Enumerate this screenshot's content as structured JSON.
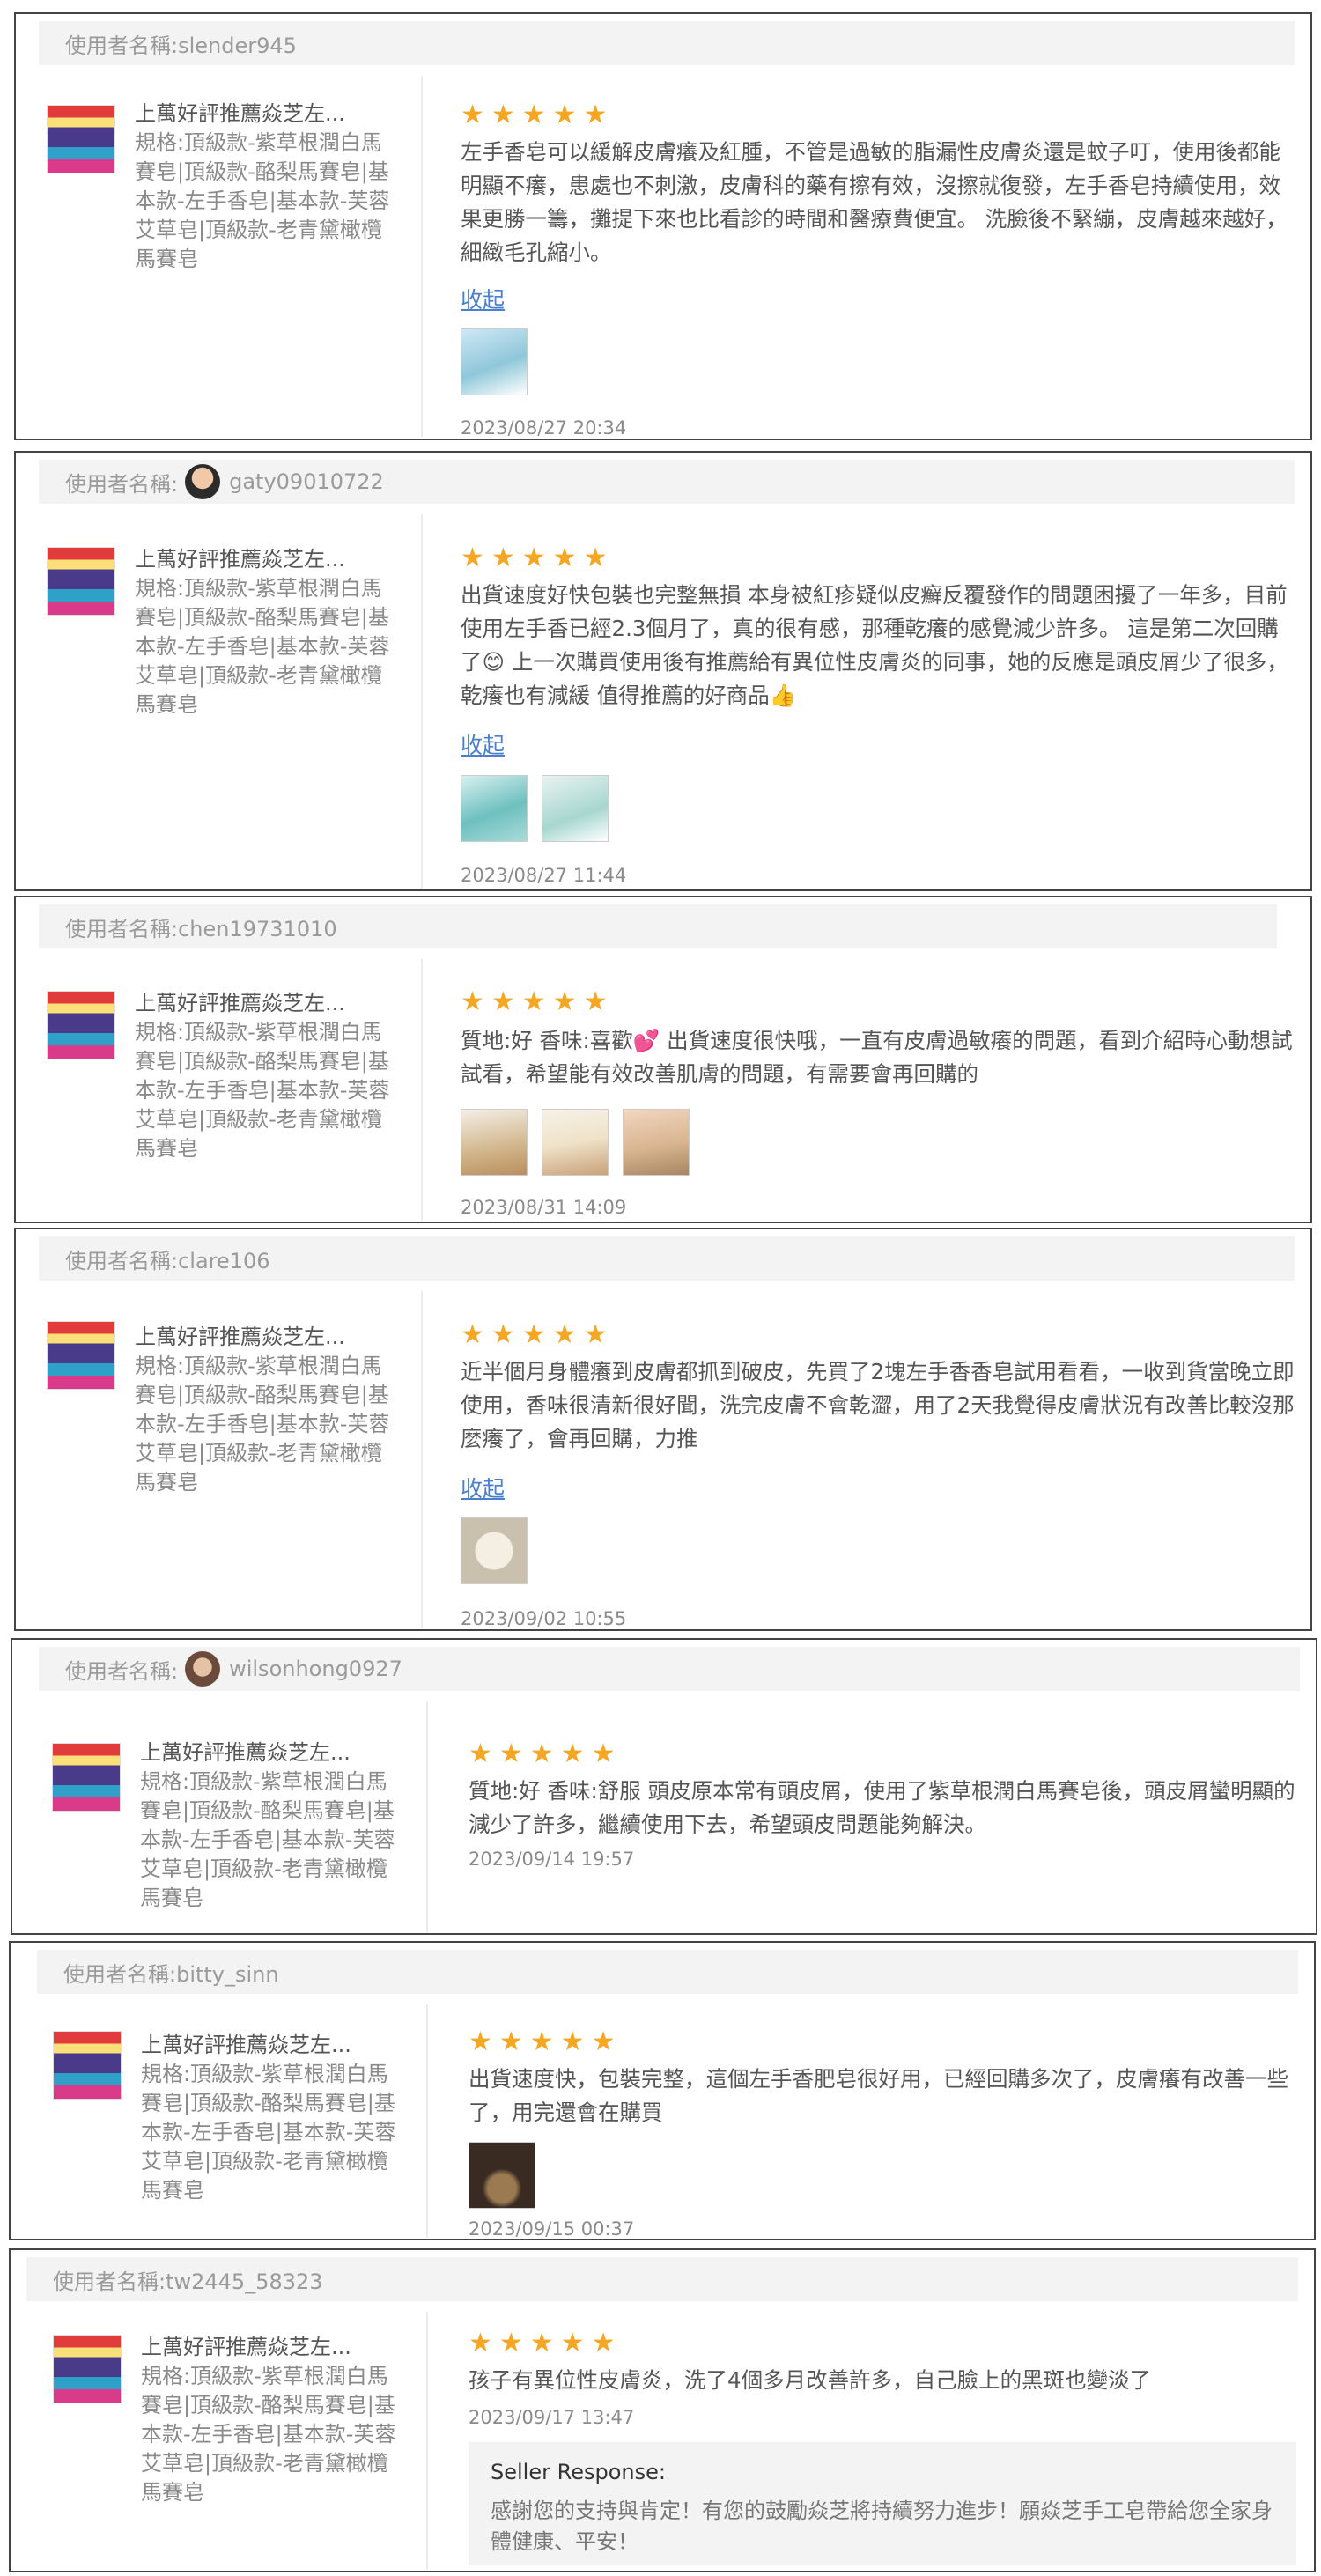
{
  "reviews": [
    {
      "username": "使用者名稱:slender945",
      "product_title": "上萬好評推薦焱芝左...",
      "product_spec": "規格:頂級款-紫草根潤白馬賽皂|頂級款-酪梨馬賽皂|基本款-左手香皂|基本款-芙蓉艾草皂|頂級款-老青黛橄欖馬賽皂",
      "rating": 5,
      "stars": "★★★★★",
      "text": "左手香皂可以緩解皮膚癢及紅腫，不管是過敏的脂漏性皮膚炎還是蚊子叮，使用後都能明顯不癢，患處也不刺激，皮膚科的藥有擦有效，沒擦就復發，左手香皂持續使用，效果更勝一籌，攤提下來也比看診的時間和醫療費便宜。 洗臉後不緊繃，皮膚越來越好，細緻毛孔縮小。",
      "collapse": "收起",
      "date": "2023/08/27 20:34"
    },
    {
      "username_prefix": "使用者名稱:",
      "username": "gaty09010722",
      "product_title": "上萬好評推薦焱芝左...",
      "product_spec": "規格:頂級款-紫草根潤白馬賽皂|頂級款-酪梨馬賽皂|基本款-左手香皂|基本款-芙蓉艾草皂|頂級款-老青黛橄欖馬賽皂",
      "rating": 5,
      "stars": "★★★★★",
      "text": "出貨速度好快包裝也完整無損 本身被紅疹疑似皮癬反覆發作的問題困擾了一年多，目前使用左手香已經2.3個月了，真的很有感，那種乾癢的感覺減少許多。 這是第二次回購了😊 上一次購買使用後有推薦給有異位性皮膚炎的同事，她的反應是頭皮屑少了很多，乾癢也有減緩 值得推薦的好商品👍",
      "collapse": "收起",
      "date": "2023/08/27 11:44"
    },
    {
      "username": "使用者名稱:chen19731010",
      "product_title": "上萬好評推薦焱芝左...",
      "product_spec": "規格:頂級款-紫草根潤白馬賽皂|頂級款-酪梨馬賽皂|基本款-左手香皂|基本款-芙蓉艾草皂|頂級款-老青黛橄欖馬賽皂",
      "rating": 5,
      "stars": "★★★★★",
      "text": "質地:好 香味:喜歡💕 出貨速度很快哦，一直有皮膚過敏癢的問題，看到介紹時心動想試試看，希望能有效改善肌膚的問題，有需要會再回購的",
      "date": "2023/08/31 14:09"
    },
    {
      "username": "使用者名稱:clare106",
      "product_title": "上萬好評推薦焱芝左...",
      "product_spec": "規格:頂級款-紫草根潤白馬賽皂|頂級款-酪梨馬賽皂|基本款-左手香皂|基本款-芙蓉艾草皂|頂級款-老青黛橄欖馬賽皂",
      "rating": 5,
      "stars": "★★★★★",
      "text": "近半個月身體癢到皮膚都抓到破皮，先買了2塊左手香香皂試用看看，一收到貨當晚立即使用，香味很清新很好聞，洗完皮膚不會乾澀，用了2天我覺得皮膚狀況有改善比較沒那麼癢了，會再回購，力推",
      "collapse": "收起",
      "date": "2023/09/02 10:55"
    },
    {
      "username_prefix": "使用者名稱:",
      "username": "wilsonhong0927",
      "product_title": "上萬好評推薦焱芝左...",
      "product_spec": "規格:頂級款-紫草根潤白馬賽皂|頂級款-酪梨馬賽皂|基本款-左手香皂|基本款-芙蓉艾草皂|頂級款-老青黛橄欖馬賽皂",
      "rating": 5,
      "stars": "★★★★★",
      "text": "質地:好 香味:舒服 頭皮原本常有頭皮屑，使用了紫草根潤白馬賽皂後，頭皮屑蠻明顯的減少了許多，繼續使用下去，希望頭皮問題能夠解決。",
      "date": "2023/09/14 19:57"
    },
    {
      "username": "使用者名稱:bitty_sinn",
      "product_title": "上萬好評推薦焱芝左...",
      "product_spec": "規格:頂級款-紫草根潤白馬賽皂|頂級款-酪梨馬賽皂|基本款-左手香皂|基本款-芙蓉艾草皂|頂級款-老青黛橄欖馬賽皂",
      "rating": 5,
      "stars": "★★★★★",
      "text": "出貨速度快，包裝完整，這個左手香肥皂很好用，已經回購多次了，皮膚癢有改善一些了，用完還會在購買",
      "date": "2023/09/15 00:37"
    },
    {
      "username": "使用者名稱:tw2445_58323",
      "product_title": "上萬好評推薦焱芝左...",
      "product_spec": "規格:頂級款-紫草根潤白馬賽皂|頂級款-酪梨馬賽皂|基本款-左手香皂|基本款-芙蓉艾草皂|頂級款-老青黛橄欖馬賽皂",
      "rating": 5,
      "stars": "★★★★★",
      "text": "孩子有異位性皮膚炎，洗了4個多月改善許多，自己臉上的黑斑也變淡了",
      "date": "2023/09/17 13:47",
      "seller_response_label": "Seller Response:",
      "seller_response_text": "感謝您的支持與肯定！有您的鼓勵焱芝將持續努力進步！願焱芝手工皂帶給您全家身體健康、平安！"
    }
  ]
}
